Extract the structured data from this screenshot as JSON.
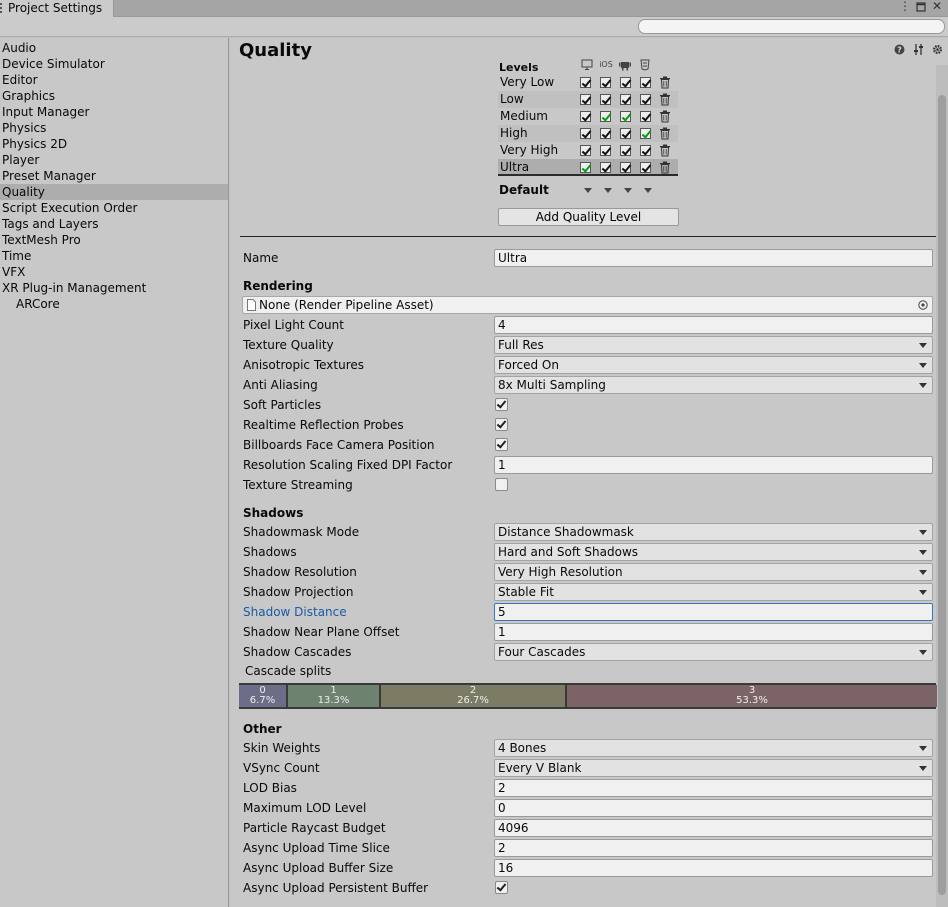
{
  "window": {
    "tab_title": "Project Settings",
    "search_placeholder": ""
  },
  "sidebar": {
    "items": [
      {
        "label": "Audio",
        "selected": false
      },
      {
        "label": "Device Simulator",
        "selected": false
      },
      {
        "label": "Editor",
        "selected": false
      },
      {
        "label": "Graphics",
        "selected": false
      },
      {
        "label": "Input Manager",
        "selected": false
      },
      {
        "label": "Physics",
        "selected": false
      },
      {
        "label": "Physics 2D",
        "selected": false
      },
      {
        "label": "Player",
        "selected": false
      },
      {
        "label": "Preset Manager",
        "selected": false
      },
      {
        "label": "Quality",
        "selected": true
      },
      {
        "label": "Script Execution Order",
        "selected": false
      },
      {
        "label": "Tags and Layers",
        "selected": false
      },
      {
        "label": "TextMesh Pro",
        "selected": false
      },
      {
        "label": "Time",
        "selected": false
      },
      {
        "label": "VFX",
        "selected": false
      },
      {
        "label": "XR Plug-in Management",
        "selected": false
      },
      {
        "label": "ARCore",
        "selected": false,
        "child": true
      }
    ]
  },
  "main": {
    "title": "Quality",
    "levels": {
      "header": "Levels",
      "platforms": [
        "standalone-icon",
        "iOS",
        "android-icon",
        "webgl-icon"
      ],
      "rows": [
        {
          "name": "Very Low",
          "checks": [
            "on",
            "on",
            "on",
            "on"
          ]
        },
        {
          "name": "Low",
          "checks": [
            "on",
            "on",
            "on",
            "on"
          ]
        },
        {
          "name": "Medium",
          "checks": [
            "on",
            "green",
            "green",
            "on"
          ]
        },
        {
          "name": "High",
          "checks": [
            "on",
            "on",
            "on",
            "green"
          ]
        },
        {
          "name": "Very High",
          "checks": [
            "on",
            "on",
            "on",
            "on"
          ]
        },
        {
          "name": "Ultra",
          "checks": [
            "green",
            "on",
            "on",
            "on"
          ],
          "selected": true
        }
      ],
      "default_label": "Default",
      "add_button": "Add Quality Level"
    },
    "name": {
      "label": "Name",
      "value": "Ultra"
    },
    "rendering": {
      "header": "Rendering",
      "pipeline_asset": "None (Render Pipeline Asset)",
      "pixel_light_count": {
        "label": "Pixel Light Count",
        "value": "4"
      },
      "texture_quality": {
        "label": "Texture Quality",
        "value": "Full Res"
      },
      "anisotropic": {
        "label": "Anisotropic Textures",
        "value": "Forced On"
      },
      "anti_aliasing": {
        "label": "Anti Aliasing",
        "value": "8x Multi Sampling"
      },
      "soft_particles": {
        "label": "Soft Particles",
        "checked": true
      },
      "realtime_reflection": {
        "label": "Realtime Reflection Probes",
        "checked": true
      },
      "billboards": {
        "label": "Billboards Face Camera Position",
        "checked": true
      },
      "dpi_factor": {
        "label": "Resolution Scaling Fixed DPI Factor",
        "value": "1"
      },
      "texture_streaming": {
        "label": "Texture Streaming",
        "checked": false
      }
    },
    "shadows": {
      "header": "Shadows",
      "shadowmask_mode": {
        "label": "Shadowmask Mode",
        "value": "Distance Shadowmask"
      },
      "shadows": {
        "label": "Shadows",
        "value": "Hard and Soft Shadows"
      },
      "resolution": {
        "label": "Shadow Resolution",
        "value": "Very High Resolution"
      },
      "projection": {
        "label": "Shadow Projection",
        "value": "Stable Fit"
      },
      "distance": {
        "label": "Shadow Distance",
        "value": "5"
      },
      "near_plane": {
        "label": "Shadow Near Plane Offset",
        "value": "1"
      },
      "cascades": {
        "label": "Shadow Cascades",
        "value": "Four Cascades"
      },
      "cascade_splits_label": "Cascade splits",
      "splits": [
        {
          "index": "0",
          "pct": "6.7%",
          "fraction": 0.067,
          "color": "#6c6d86"
        },
        {
          "index": "1",
          "pct": "13.3%",
          "fraction": 0.133,
          "color": "#6e8270"
        },
        {
          "index": "2",
          "pct": "26.7%",
          "fraction": 0.267,
          "color": "#7c7c64"
        },
        {
          "index": "3",
          "pct": "53.3%",
          "fraction": 0.533,
          "color": "#7c6466"
        }
      ]
    },
    "other": {
      "header": "Other",
      "skin_weights": {
        "label": "Skin Weights",
        "value": "4 Bones"
      },
      "vsync": {
        "label": "VSync Count",
        "value": "Every V Blank"
      },
      "lod_bias": {
        "label": "LOD Bias",
        "value": "2"
      },
      "max_lod": {
        "label": "Maximum LOD Level",
        "value": "0"
      },
      "raycast_budget": {
        "label": "Particle Raycast Budget",
        "value": "4096"
      },
      "upload_time": {
        "label": "Async Upload Time Slice",
        "value": "2"
      },
      "upload_buffer": {
        "label": "Async Upload Buffer Size",
        "value": "16"
      },
      "upload_persistent": {
        "label": "Async Upload Persistent Buffer",
        "checked": true
      }
    }
  }
}
